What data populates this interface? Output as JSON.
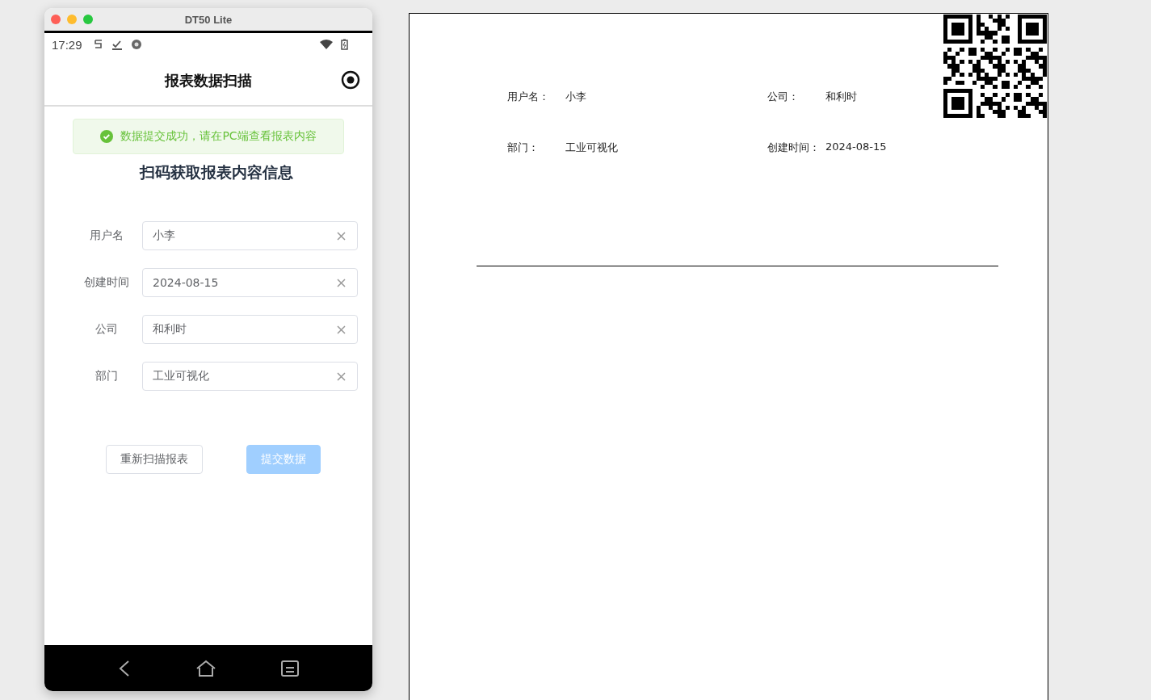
{
  "window": {
    "title": "DT50 Lite"
  },
  "status_bar": {
    "time": "17:29"
  },
  "app_bar": {
    "title": "报表数据扫描"
  },
  "alert": {
    "kind": "success",
    "message": "数据提交成功，请在PC端查看报表内容"
  },
  "heading": "扫码获取报表内容信息",
  "form": {
    "fields": [
      {
        "label": "用户名",
        "value": "小李"
      },
      {
        "label": "创建时间",
        "value": "2024-08-15"
      },
      {
        "label": "公司",
        "value": "和利时"
      },
      {
        "label": "部门",
        "value": "工业可视化"
      }
    ]
  },
  "buttons": [
    {
      "label": "重新扫描报表",
      "kind": "default",
      "disabled": false
    },
    {
      "label": "提交数据",
      "kind": "primary",
      "disabled": true
    }
  ],
  "report": {
    "fields": [
      {
        "label": "用户名：",
        "value": "小李"
      },
      {
        "label": "公司：",
        "value": "和利时"
      },
      {
        "label": "部门：",
        "value": "工业可视化"
      },
      {
        "label": "创建时间：",
        "value": "2024-08-15"
      }
    ]
  }
}
